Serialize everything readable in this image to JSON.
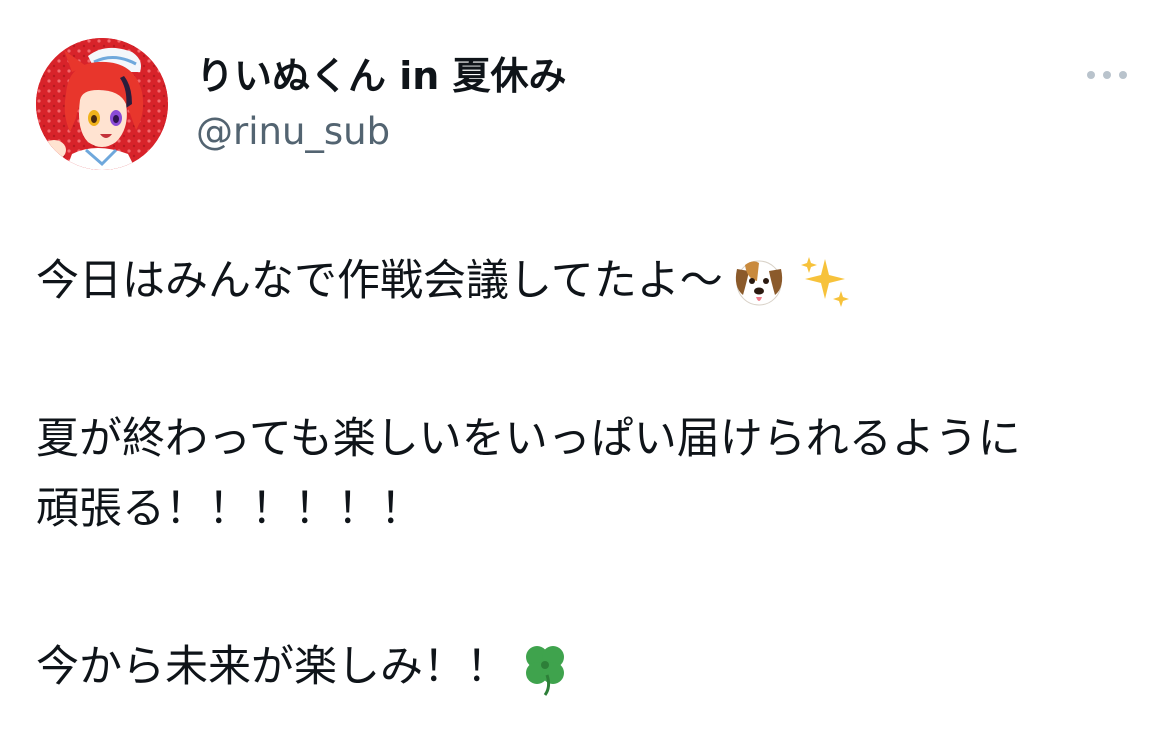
{
  "author": {
    "display_name": "りいぬくん in 夏休み",
    "handle": "@rinu_sub"
  },
  "menu": {
    "more_icon": "more-horizontal-icon"
  },
  "tweet": {
    "line1": "今日はみんなで作戦会議してたよ〜",
    "line1_emojis": [
      "dog-face-emoji",
      "sparkles-emoji"
    ],
    "line2a": "夏が終わっても楽しいをいっぱい届けられるように",
    "line2b": "頑張る！！！！！！",
    "line3": "今から未来が楽しみ！！",
    "line3_emojis": [
      "four-leaf-clover-emoji"
    ]
  },
  "colors": {
    "text_primary": "#0f1419",
    "text_secondary": "#536471",
    "avatar_bg": "#d8232a"
  }
}
